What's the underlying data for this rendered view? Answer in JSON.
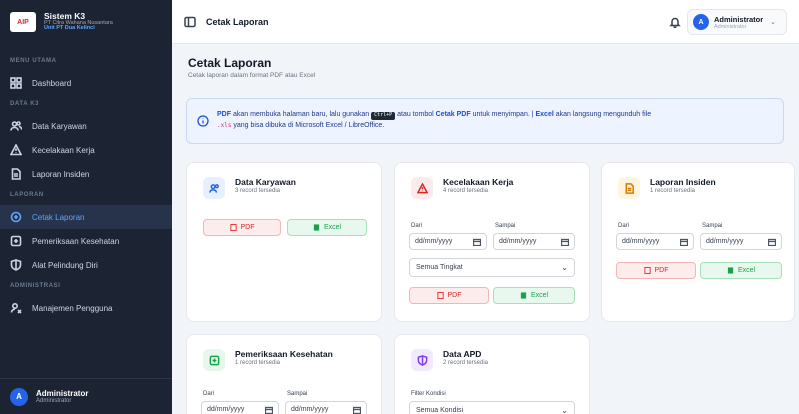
{
  "brand": {
    "logo_text": "AIP",
    "title": "Sistem K3",
    "company": "PT Citra Wahana Nusantara",
    "unit": "Unit PT Dua Kelinci"
  },
  "sidebar": {
    "sections": [
      "MENU UTAMA",
      "DATA K3",
      "LAPORAN",
      "ADMINISTRASI"
    ],
    "items": [
      {
        "label": "Dashboard",
        "icon": "dashboard-icon"
      },
      {
        "label": "Data Karyawan",
        "icon": "users-icon"
      },
      {
        "label": "Kecelakaan Kerja",
        "icon": "warning-icon"
      },
      {
        "label": "Laporan Insiden",
        "icon": "document-icon"
      },
      {
        "label": "Cetak Laporan",
        "icon": "print-icon",
        "active": true
      },
      {
        "label": "Pemeriksaan Kesehatan",
        "icon": "health-icon"
      },
      {
        "label": "Alat Pelindung Diri",
        "icon": "shield-icon"
      },
      {
        "label": "Manajemen Pengguna",
        "icon": "user-settings-icon"
      }
    ],
    "user": {
      "initial": "A",
      "name": "Administrator",
      "role": "Administrator"
    }
  },
  "topbar": {
    "title": "Cetak Laporan",
    "user_initial": "A",
    "user_name": "Administrator",
    "user_role": "Administrator"
  },
  "page": {
    "title": "Cetak Laporan",
    "subtitle": "Cetak laporan dalam format PDF atau Excel"
  },
  "info": {
    "pdf": "PDF",
    "text1": " akan membuka halaman baru, lalu gunakan ",
    "kbd": "Ctrl+P",
    "text2": " atau tombol ",
    "cetak": "Cetak PDF",
    "text3": " untuk menyimpan. | ",
    "excel": "Excel",
    "text4": " akan langsung mengunduh file",
    "ext": ".xls",
    "text5": " yang bisa dibuka di Microsoft Excel / LibreOffice."
  },
  "buttons": {
    "pdf": "PDF",
    "excel": "Excel"
  },
  "fields": {
    "from": "Dari",
    "to": "Sampai",
    "date_placeholder": "dd/mm/yyyy",
    "filter_condition": "Filter Kondisi"
  },
  "cards": {
    "karyawan": {
      "title": "Data Karyawan",
      "count": "3 record tersedia"
    },
    "kecelakaan": {
      "title": "Kecelakaan Kerja",
      "count": "4 record tersedia",
      "select": "Semua Tingkat"
    },
    "insiden": {
      "title": "Laporan Insiden",
      "count": "1 record tersedia"
    },
    "kesehatan": {
      "title": "Pemeriksaan Kesehatan",
      "count": "1 record tersedia"
    },
    "apd": {
      "title": "Data APD",
      "count": "2 record tersedia",
      "select": "Semua Kondisi"
    }
  },
  "colors": {
    "sidebar": "#1c2433",
    "accent": "#2563eb",
    "pdf": "#dc2626",
    "excel": "#16a34a"
  }
}
